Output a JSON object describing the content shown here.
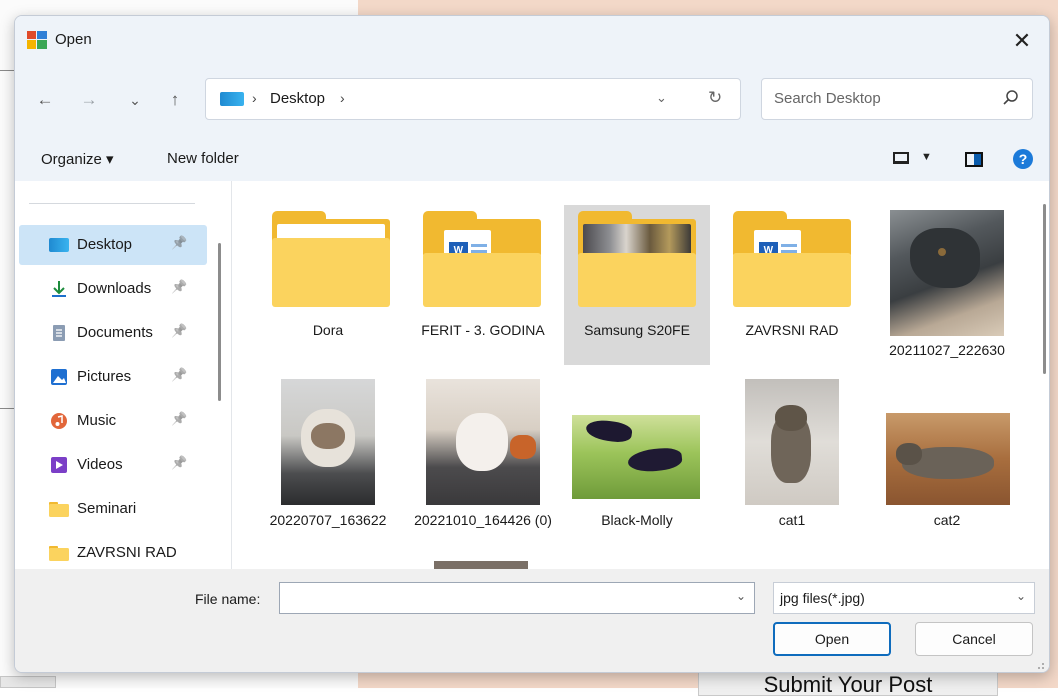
{
  "background": {
    "submit_label": "Submit Your Post"
  },
  "dialog": {
    "title": "Open",
    "close_glyph": "✕"
  },
  "nav": {
    "back_glyph": "←",
    "forward_glyph": "→",
    "recent_glyph": "⌄",
    "up_glyph": "↑"
  },
  "address": {
    "separator": "›",
    "crumb": "Desktop",
    "dropdown_glyph": "⌄",
    "refresh_glyph": "↻"
  },
  "search": {
    "placeholder": "Search Desktop"
  },
  "commandbar": {
    "organize_label": "Organize ▾",
    "new_folder_label": "New folder",
    "view_dropdown_glyph": "▼",
    "help_glyph": "?"
  },
  "sidebar": {
    "pin_glyph": "📌",
    "items": [
      {
        "label": "Desktop",
        "icon": "desktop-icon",
        "pinned": true,
        "selected": true
      },
      {
        "label": "Downloads",
        "icon": "download-icon",
        "pinned": true
      },
      {
        "label": "Documents",
        "icon": "documents-icon",
        "pinned": true
      },
      {
        "label": "Pictures",
        "icon": "pictures-icon",
        "pinned": true
      },
      {
        "label": "Music",
        "icon": "music-icon",
        "pinned": true
      },
      {
        "label": "Videos",
        "icon": "videos-icon",
        "pinned": true
      },
      {
        "label": "Seminari",
        "icon": "folder-icon",
        "pinned": false
      },
      {
        "label": "ZAVRSNI RAD",
        "icon": "folder-icon",
        "pinned": false
      }
    ]
  },
  "files": [
    {
      "name": "Dora",
      "kind": "folder"
    },
    {
      "name": "FERIT - 3. GODINA",
      "kind": "folder-word"
    },
    {
      "name": "Samsung S20FE",
      "kind": "folder-photo",
      "selected": true
    },
    {
      "name": "ZAVRSNI RAD",
      "kind": "folder-word"
    },
    {
      "name": "20211027_222630",
      "kind": "image"
    },
    {
      "name": "20220707_163622",
      "kind": "image"
    },
    {
      "name": "20221010_164426 (0)",
      "kind": "image"
    },
    {
      "name": "Black-Molly",
      "kind": "image"
    },
    {
      "name": "cat1",
      "kind": "image"
    },
    {
      "name": "cat2",
      "kind": "image"
    }
  ],
  "bottom": {
    "file_name_label": "File name:",
    "file_name_value": "",
    "dropdown_glyph": "⌄",
    "filter_value": "jpg files(*.jpg)",
    "open_label": "Open",
    "cancel_label": "Cancel"
  },
  "colors": {
    "accent": "#0f6cbd",
    "selection": "#cce4f7",
    "folder": "#fbd35e"
  }
}
